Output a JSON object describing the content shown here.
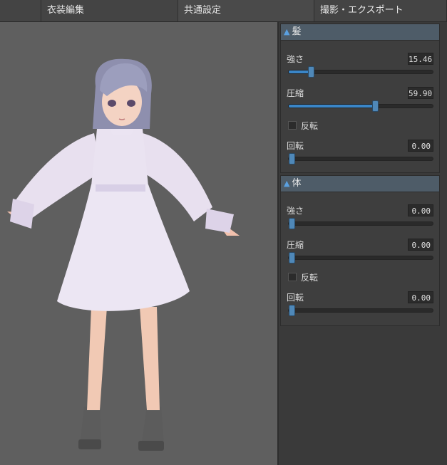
{
  "tabs": [
    {
      "label": ""
    },
    {
      "label": "衣装編集"
    },
    {
      "label": "共通設定"
    },
    {
      "label": "撮影・エクスポート"
    }
  ],
  "sections": [
    {
      "title": "髪",
      "strength": {
        "label": "強さ",
        "value": "15.46",
        "fraction": 0.155
      },
      "compress": {
        "label": "圧縮",
        "value": "59.90",
        "fraction": 0.599
      },
      "invert": {
        "label": "反転",
        "checked": false
      },
      "rotate": {
        "label": "回転",
        "value": "0.00",
        "fraction": 0
      }
    },
    {
      "title": "体",
      "strength": {
        "label": "強さ",
        "value": "0.00",
        "fraction": 0
      },
      "compress": {
        "label": "圧縮",
        "value": "0.00",
        "fraction": 0
      },
      "invert": {
        "label": "反転",
        "checked": false
      },
      "rotate": {
        "label": "回転",
        "value": "0.00",
        "fraction": 0
      }
    }
  ],
  "colors": {
    "accent": "#3a86c8",
    "panel": "#3a3a3a",
    "viewport": "#5f5f5f"
  }
}
